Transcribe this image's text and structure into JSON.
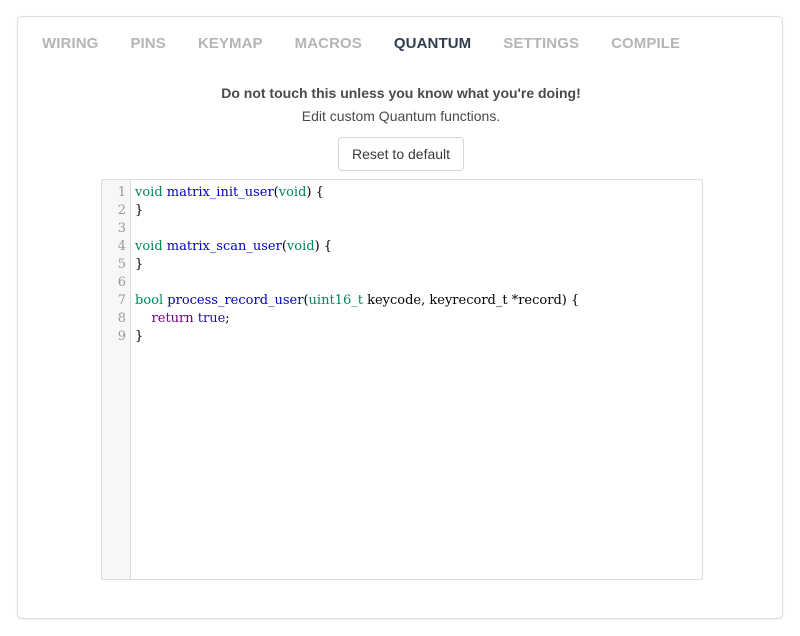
{
  "tabs": [
    {
      "label": "WIRING",
      "active": false
    },
    {
      "label": "PINS",
      "active": false
    },
    {
      "label": "KEYMAP",
      "active": false
    },
    {
      "label": "MACROS",
      "active": false
    },
    {
      "label": "QUANTUM",
      "active": true
    },
    {
      "label": "SETTINGS",
      "active": false
    },
    {
      "label": "COMPILE",
      "active": false
    }
  ],
  "warning": "Do not touch this unless you know what you're doing!",
  "subtitle": "Edit custom Quantum functions.",
  "reset_button": "Reset to default",
  "editor": {
    "line_numbers": [
      "1",
      "2",
      "3",
      "4",
      "5",
      "6",
      "7",
      "8",
      "9"
    ],
    "lines": [
      [
        {
          "t": "void",
          "c": "kw-type"
        },
        {
          "t": " "
        },
        {
          "t": "matrix_init_user",
          "c": "kw-fn"
        },
        {
          "t": "("
        },
        {
          "t": "void",
          "c": "kw-type"
        },
        {
          "t": ") {"
        }
      ],
      [
        {
          "t": "}"
        }
      ],
      [],
      [
        {
          "t": "void",
          "c": "kw-type"
        },
        {
          "t": " "
        },
        {
          "t": "matrix_scan_user",
          "c": "kw-fn"
        },
        {
          "t": "("
        },
        {
          "t": "void",
          "c": "kw-type"
        },
        {
          "t": ") {"
        }
      ],
      [
        {
          "t": "}"
        }
      ],
      [],
      [
        {
          "t": "bool",
          "c": "kw-type"
        },
        {
          "t": " "
        },
        {
          "t": "process_record_user",
          "c": "kw-fn"
        },
        {
          "t": "("
        },
        {
          "t": "uint16_t",
          "c": "kw-type"
        },
        {
          "t": " keycode, keyrecord_t *record) {"
        }
      ],
      [
        {
          "t": "    "
        },
        {
          "t": "return",
          "c": "kw-ret"
        },
        {
          "t": " "
        },
        {
          "t": "true",
          "c": "kw-atom"
        },
        {
          "t": ";"
        }
      ],
      [
        {
          "t": "}"
        }
      ]
    ]
  },
  "colors": {
    "tab_inactive": "#b5b5b5",
    "tab_active": "#2f3e4e",
    "type_keyword": "#008855",
    "function_name": "#0000cc",
    "return_keyword": "#770088",
    "atom": "#221199"
  }
}
